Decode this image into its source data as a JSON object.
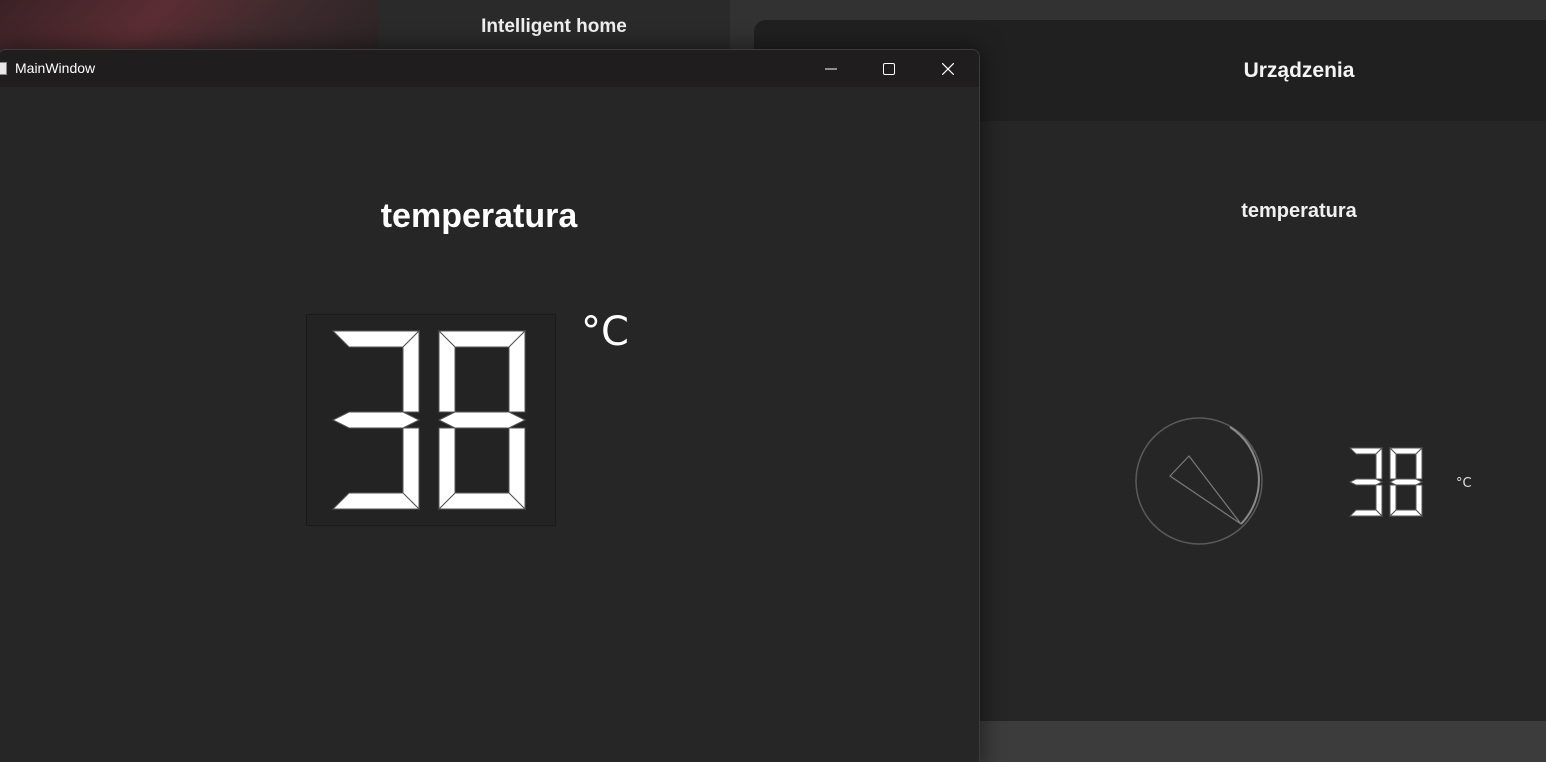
{
  "background": {
    "app_title": "Intelligent home",
    "devices_header": "Urządzenia",
    "sensor_title": "temperatura",
    "display_value": "38",
    "unit": "°C"
  },
  "window": {
    "title": "MainWindow",
    "controls": {
      "minimize_icon": "minimize-icon",
      "maximize_icon": "maximize-icon",
      "close_icon": "close-icon"
    }
  },
  "sensor": {
    "title": "temperatura",
    "display_value": "38",
    "unit": "°C"
  },
  "colors": {
    "window_bg": "#262626",
    "titlebar_bg": "#1f1d1e",
    "text": "#ffffff",
    "lcd_segment": "#ffffff"
  }
}
